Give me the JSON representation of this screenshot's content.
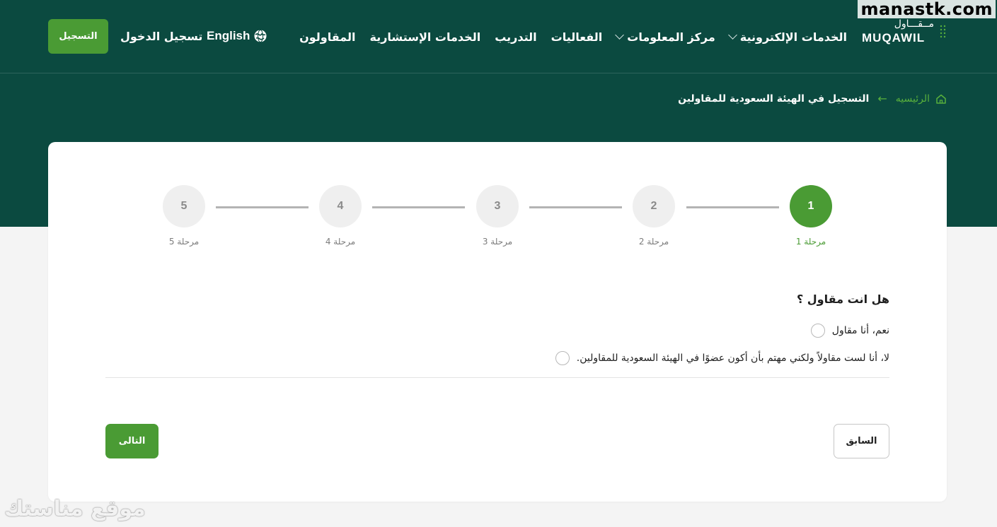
{
  "watermark_top": "manastk.com",
  "watermark_bottom": "موقع مناستك",
  "logo": {
    "arabic": "مــقـــاول",
    "english": "MUQAWIL"
  },
  "nav": {
    "items": [
      {
        "label": "المقاولون",
        "has_dropdown": false
      },
      {
        "label": "الخدمات الإستشارية",
        "has_dropdown": false
      },
      {
        "label": "التدريب",
        "has_dropdown": false
      },
      {
        "label": "الفعاليات",
        "has_dropdown": false
      },
      {
        "label": "مركز المعلومات",
        "has_dropdown": true
      },
      {
        "label": "الخدمات الإلكترونية",
        "has_dropdown": true
      }
    ],
    "language": "English",
    "login": "تسجيل الدخول",
    "register": "التسجيل"
  },
  "breadcrumb": {
    "home": "الرئيسيه",
    "current": "التسجيل في الهيئة السعودية للمقاولين"
  },
  "steps": [
    {
      "number": "1",
      "label": "مرحلة 1",
      "active": true
    },
    {
      "number": "2",
      "label": "مرحلة 2",
      "active": false
    },
    {
      "number": "3",
      "label": "مرحلة 3",
      "active": false
    },
    {
      "number": "4",
      "label": "مرحلة 4",
      "active": false
    },
    {
      "number": "5",
      "label": "مرحلة 5",
      "active": false
    }
  ],
  "form": {
    "question": "هل انت مقاول ؟",
    "options": [
      {
        "label": "نعم، أنا مقاول",
        "selected": false
      },
      {
        "label": "لا، أنا لست مقاولاً ولكني مهتم بأن أكون عضوًا في الهيئة السعودية للمقاولين.",
        "selected": false
      }
    ],
    "prev_label": "السابق",
    "next_label": "التالى"
  },
  "colors": {
    "header_bg": "#0b4a40",
    "accent_green": "#4a9b34",
    "page_bg": "#f4f4f4"
  }
}
